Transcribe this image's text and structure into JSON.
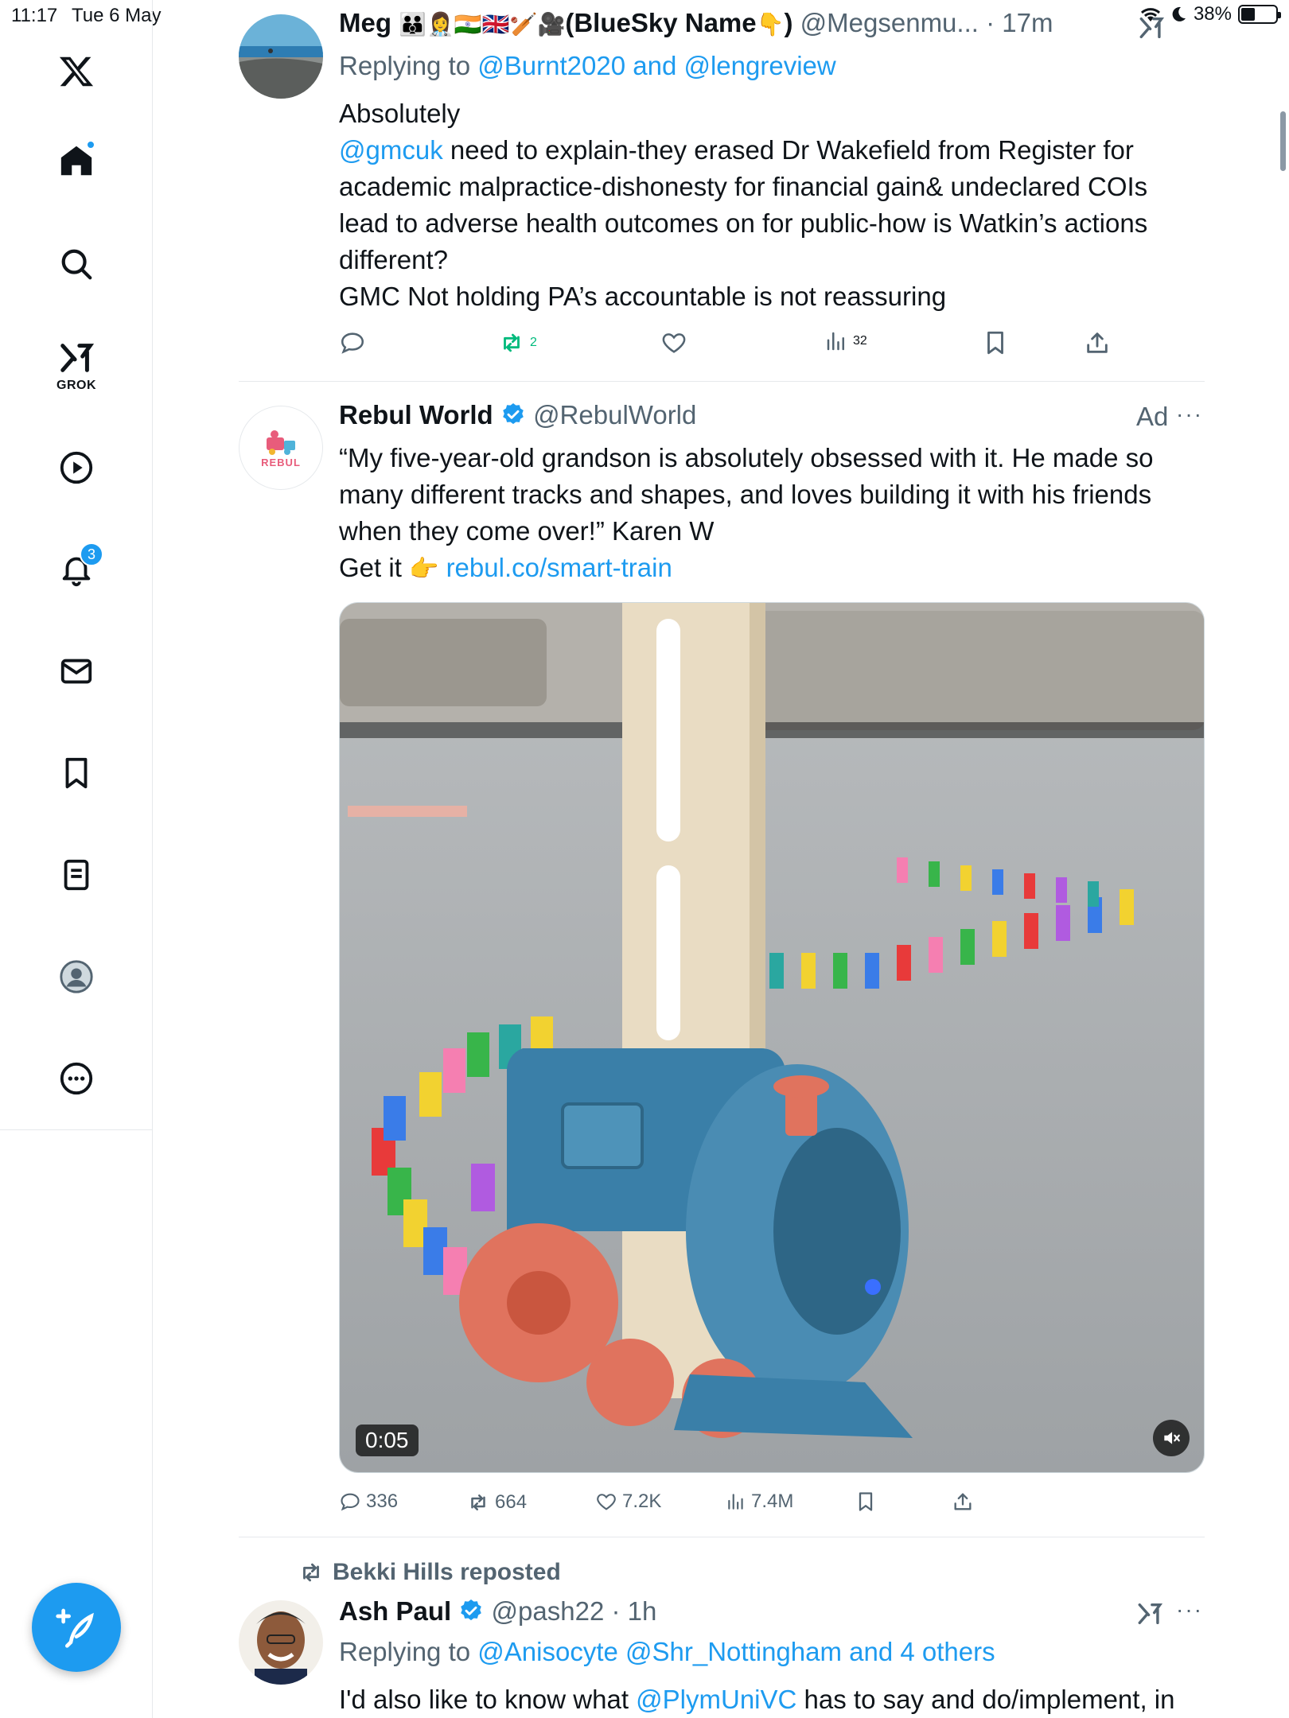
{
  "status_bar": {
    "time": "11:17",
    "date": "Tue 6 May",
    "battery": "38%",
    "battery_level": 0.38
  },
  "sidebar": {
    "grok_label": "GROK",
    "notifications_badge": "3"
  },
  "post1": {
    "name": "Meg",
    "name_suffix": "(BlueSky Name",
    "name_close": ")",
    "handle": "@Megsenmu...",
    "time": "· 17m",
    "replying_to_prefix": "Replying to",
    "replying_to_users": "@Burnt2020 and @lengreview",
    "body_line1": "Absolutely",
    "mention": "@gmcuk",
    "body_rest1": " need to explain-they erased Dr Wakefield from Register for",
    "body_line3": "academic malpractice-dishonesty for financial gain& undeclared COIs",
    "body_line4": "lead to adverse health outcomes on for public-how is Watkin’s actions",
    "body_line5": "different?",
    "body_line6": "GMC Not holding PA’s accountable is not reassuring",
    "reposts": "2",
    "views": "32"
  },
  "post2": {
    "name": "Rebul World",
    "handle": "@RebulWorld",
    "ad_label": "Ad",
    "avatar_brand": "REBUL",
    "body_line1": "“My five-year-old grandson is absolutely obsessed with it. He made so",
    "body_line2": "many different tracks and shapes, and loves building it with his friends",
    "body_line3": "when they come over!” Karen W",
    "body_line4_prefix": "Get it ",
    "link": "rebul.co/smart-train",
    "video_time": "0:05",
    "replies": "336",
    "reposts": "664",
    "likes": "7.2K",
    "views": "7.4M"
  },
  "post3": {
    "reposted_by": "Bekki Hills reposted",
    "name": "Ash Paul",
    "handle": "@pash22",
    "time": "· 1h",
    "replying_to_prefix": "Replying to",
    "replying_to_users": "@Anisocyte @Shr_Nottingham and 4 others",
    "body_prefix": "I'd also like to know what ",
    "mention": "@PlymUniVC",
    "body_rest": " has to say and do/implement, in"
  },
  "colors": {
    "accent": "#1d9bf0",
    "repost_green": "#00ba7c",
    "muted": "#536471",
    "divider": "#e6e9ec"
  }
}
